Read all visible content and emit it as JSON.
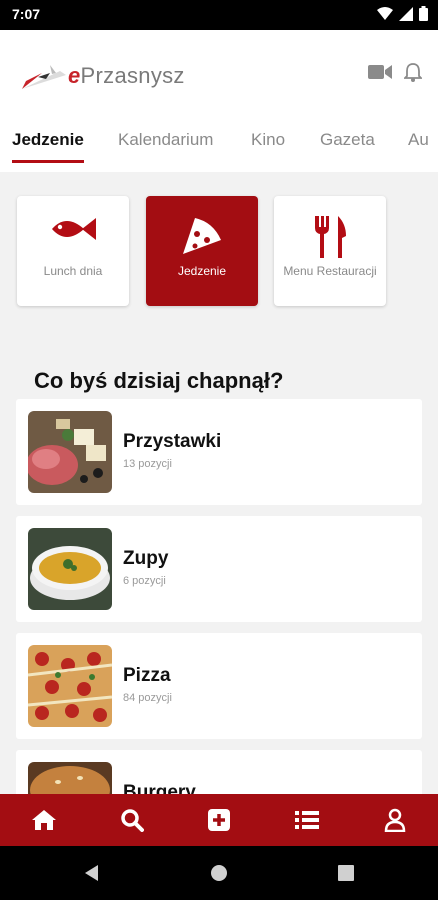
{
  "status_bar": {
    "time": "7:07"
  },
  "app": {
    "logo_prefix": "e",
    "logo_name": "Przasnysz"
  },
  "tabs": [
    {
      "label": "Jedzenie",
      "active": true
    },
    {
      "label": "Kalendarium"
    },
    {
      "label": "Kino"
    },
    {
      "label": "Gazeta"
    },
    {
      "label": "Au"
    }
  ],
  "categories": [
    {
      "label": "Lunch dnia",
      "icon": "fish-icon"
    },
    {
      "label": "Jedzenie",
      "icon": "pizza-slice-icon",
      "active": true
    },
    {
      "label": "Menu Restauracji",
      "icon": "fork-knife-icon"
    }
  ],
  "section_title": "Co byś dzisiaj chapnął?",
  "food_list": [
    {
      "name": "Przystawki",
      "count": "13 pozycji"
    },
    {
      "name": "Zupy",
      "count": "6 pozycji"
    },
    {
      "name": "Pizza",
      "count": "84 pozycji"
    },
    {
      "name": "Burgery",
      "count": ""
    }
  ],
  "bottom_nav": [
    "home-icon",
    "search-icon",
    "add-icon",
    "list-icon",
    "profile-icon"
  ],
  "colors": {
    "accent": "#a30d12",
    "logo_red": "#c7232a"
  }
}
